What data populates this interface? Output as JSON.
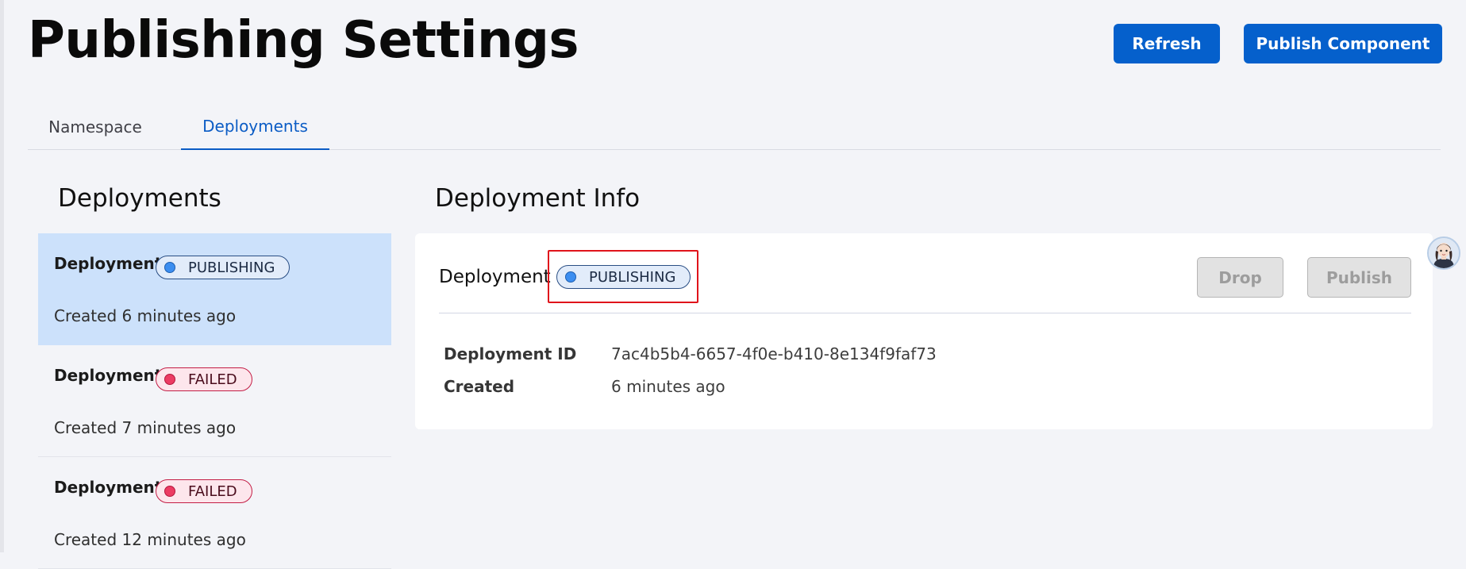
{
  "page": {
    "title": "Publishing Settings",
    "actions": {
      "refresh_label": "Refresh",
      "publish_component_label": "Publish Component"
    }
  },
  "tabs": [
    {
      "label": "Namespace",
      "active": false
    },
    {
      "label": "Deployments",
      "active": true
    }
  ],
  "deployments_panel": {
    "title": "Deployments",
    "items": [
      {
        "name": "Deployment",
        "status": "PUBLISHING",
        "created": "Created 6 minutes ago",
        "selected": true
      },
      {
        "name": "Deployment",
        "status": "FAILED",
        "created": "Created 7 minutes ago",
        "selected": false
      },
      {
        "name": "Deployment",
        "status": "FAILED",
        "created": "Created 12 minutes ago",
        "selected": false
      }
    ]
  },
  "info_panel": {
    "title": "Deployment Info",
    "name": "Deployment",
    "status": "PUBLISHING",
    "buttons": {
      "drop_label": "Drop",
      "publish_label": "Publish"
    },
    "fields": [
      {
        "label": "Deployment ID",
        "value": "7ac4b5b4-6657-4f0e-b410-8e134f9faf73"
      },
      {
        "label": "Created",
        "value": "6 minutes ago"
      }
    ]
  },
  "colors": {
    "primary": "#0560cc",
    "selected_row": "#cce1fb",
    "publishing_dot": "#3c8ef0",
    "failed_dot": "#ec3c63",
    "highlight": "#e0141b"
  },
  "icons": {
    "publishing_status": "status-dot-icon",
    "failed_status": "status-dot-icon",
    "assistant": "avatar-icon"
  }
}
